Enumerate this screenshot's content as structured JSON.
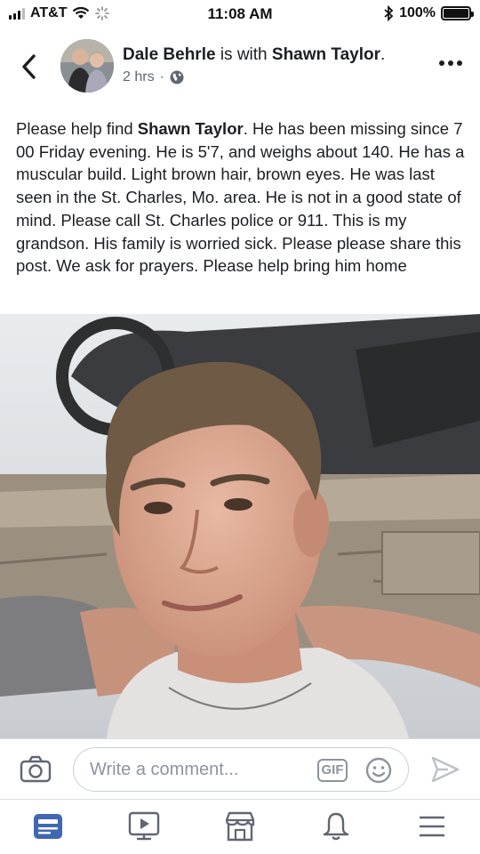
{
  "status_bar": {
    "carrier": "AT&T",
    "time": "11:08 AM",
    "battery": "100%",
    "battery_level": 1.0
  },
  "post": {
    "author": "Dale Behrle",
    "with_text": "is with",
    "tagged": "Shawn Taylor",
    "period": ".",
    "time_ago": "2 hrs",
    "separator": "·",
    "body_prefix": "Please help find ",
    "body_name": "Shawn Taylor",
    "body_rest": ". He has been missing since 7 00 Friday evening. He is 5'7, and weighs about 140. He has a muscular build. Light brown hair, brown eyes. He was last seen in the St. Charles, Mo. area. He is not in a good state of mind. Please call St. Charles police or 911. This is my grandson. His family is worried sick. Please please share this post. We ask for prayers. Please help bring him home"
  },
  "comment": {
    "placeholder": "Write a comment...",
    "gif_label": "GIF"
  },
  "icons": {
    "back": "chevron-left-icon",
    "more": "more-dots-icon",
    "privacy": "globe-icon",
    "camera": "camera-icon",
    "emoji": "smiley-icon",
    "send": "send-icon",
    "tabs": [
      "news-feed-icon",
      "watch-icon",
      "marketplace-icon",
      "notifications-icon",
      "menu-icon"
    ]
  },
  "colors": {
    "accent": "#4267b2",
    "muted": "#8d949e",
    "text": "#1c1e21"
  }
}
